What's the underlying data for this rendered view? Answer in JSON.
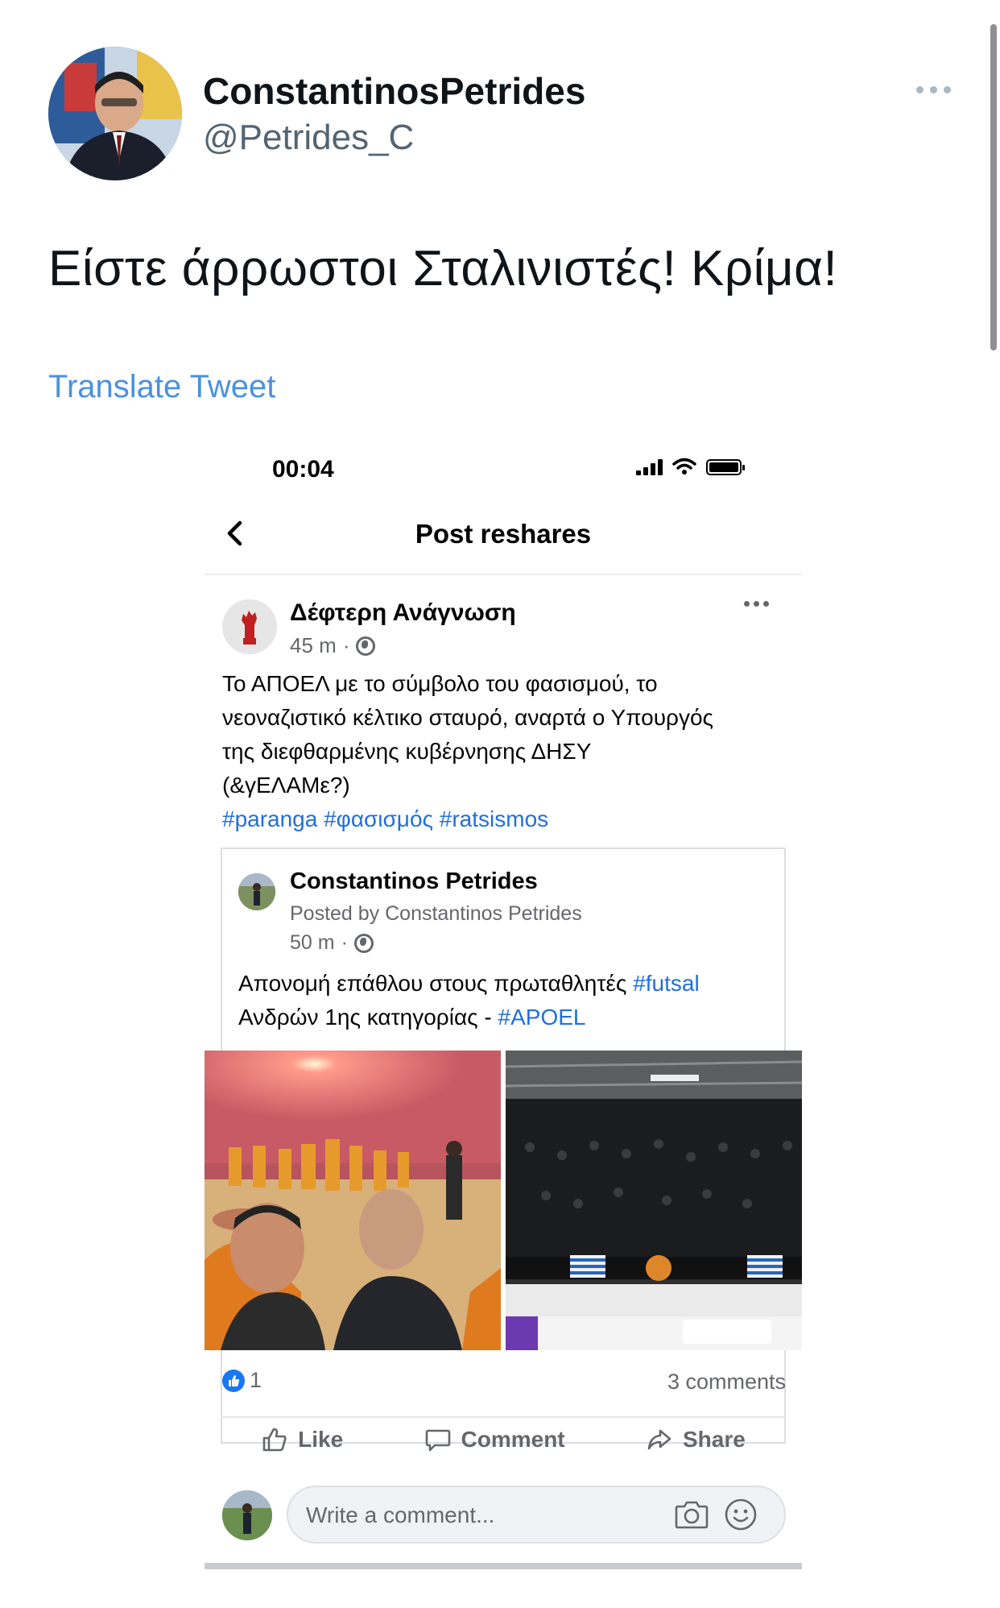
{
  "tweet": {
    "display_name": "ConstantinosPetrides",
    "handle": "@Petrides_C",
    "text": "Είστε άρρωστοι Σταλινιστές! Κρίμα!",
    "translate_label": "Translate Tweet",
    "more_icon": "more-horizontal-icon"
  },
  "embedded_screenshot": {
    "status_bar": {
      "time": "00:04"
    },
    "nav": {
      "back_icon": "chevron-left-icon",
      "title": "Post reshares"
    },
    "post": {
      "author": "Δέφτερη Ανάγνωση",
      "time": "45 m",
      "audience_icon": "globe-icon",
      "text_lines": [
        "Το ΑΠΟΕΛ με το σύμβολο του φασισμού, το",
        "νεοναζιστικό κέλτικο σταυρό, αναρτά ο Υπουργός",
        "της διεφθαρμένης κυβέρνησης ΔΗΣΥ",
        "(&γΕΛΑΜε?)"
      ],
      "hashtags": "#paranga #φασισμός #ratsismos",
      "shared": {
        "author": "Constantinos Petrides",
        "posted_by": "Posted by Constantinos Petrides",
        "time": "50 m",
        "text_line1_prefix": "Απονομή επάθλου στους πρωταθλητές ",
        "text_line1_tag": "#futsal",
        "text_line2_prefix": "Ανδρών 1ης κατηγορίας - ",
        "text_line2_tag": "#APOEL"
      },
      "reactions_count": "1",
      "comments_count": "3 comments",
      "actions": {
        "like": "Like",
        "comment": "Comment",
        "share": "Share"
      },
      "comment_placeholder": "Write a comment..."
    }
  },
  "colors": {
    "link_blue": "#4a90e2",
    "fb_blue": "#1877f2",
    "hashtag_blue": "#216fdb",
    "secondary_text": "#65676b"
  }
}
